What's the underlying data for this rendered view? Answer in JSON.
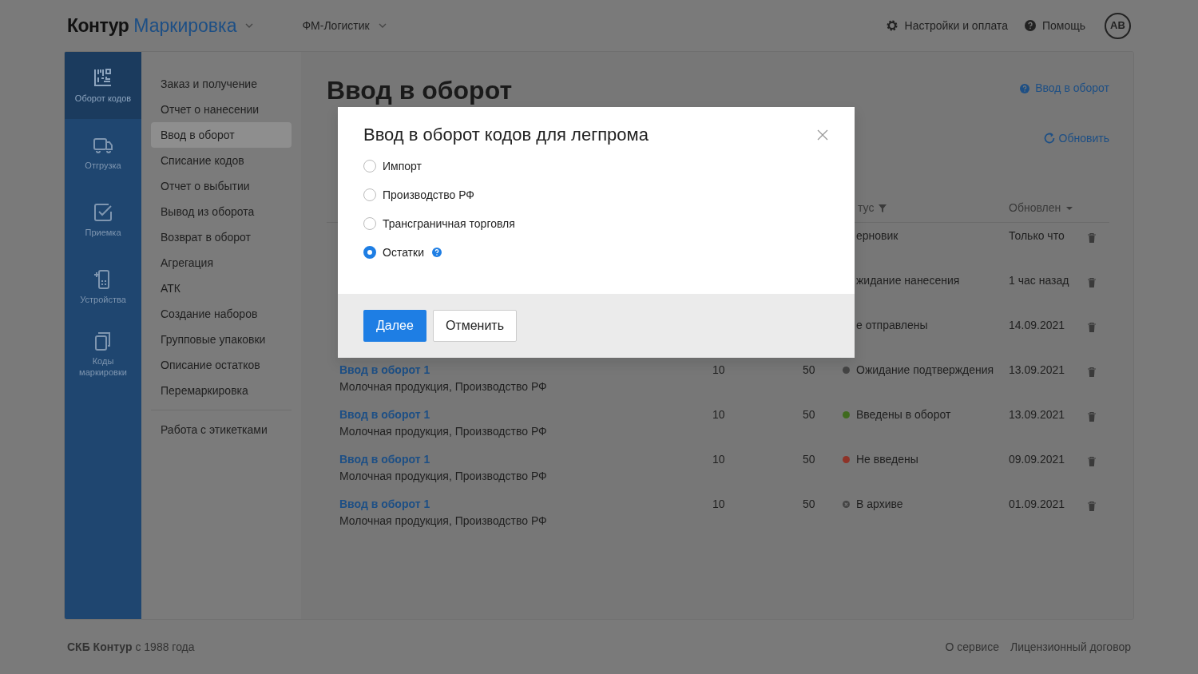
{
  "topbar": {
    "brand": "Контур",
    "product": "Маркировка",
    "org": "ФМ-Логистик",
    "settings": "Настройки и оплата",
    "help": "Помощь",
    "avatar": "AB"
  },
  "rail": [
    {
      "label": "Оборот кодов",
      "selected": true
    },
    {
      "label": "Отгрузка",
      "selected": false
    },
    {
      "label": "Приемка",
      "selected": false
    },
    {
      "label": "Устройства",
      "selected": false
    },
    {
      "label": "Коды маркировки",
      "selected": false
    }
  ],
  "nav": [
    [
      {
        "label": "Заказ и получение",
        "selected": false
      },
      {
        "label": "Отчет о нанесении",
        "selected": false
      },
      {
        "label": "Ввод в оборот",
        "selected": true
      },
      {
        "label": "Списание кодов",
        "selected": false
      },
      {
        "label": "Отчет о выбытии",
        "selected": false
      },
      {
        "label": "Вывод из оборота",
        "selected": false
      },
      {
        "label": "Возврат в оборот",
        "selected": false
      },
      {
        "label": "Агрегация",
        "selected": false
      },
      {
        "label": "АТК",
        "selected": false
      },
      {
        "label": "Создание наборов",
        "selected": false
      },
      {
        "label": "Групповые упаковки",
        "selected": false
      },
      {
        "label": "Описание остатков",
        "selected": false
      },
      {
        "label": "Перемаркировка",
        "selected": false
      }
    ],
    [
      {
        "label": "Работа с этикетками",
        "selected": false
      }
    ]
  ],
  "content": {
    "title": "Ввод в оборот",
    "help_link": "Ввод в оборот",
    "refresh": "Обновить"
  },
  "table": {
    "columns": [
      {
        "label": "тус",
        "kind": "filter"
      },
      {
        "label": "Обновлен",
        "kind": "sort"
      }
    ],
    "rows": [
      {
        "kind": "plain",
        "status": "ерновик",
        "updated": "Только что"
      },
      {
        "kind": "plain",
        "status": "жидание нанесения",
        "updated": "1 час назад"
      },
      {
        "kind": "plain",
        "status": "е отправлены",
        "updated": "14.09.2021"
      },
      {
        "kind": "dot",
        "color": "#444444",
        "title": "Ввод в оборот 1",
        "subtitle": "Молочная продукция, Производство РФ",
        "count": "10",
        "total": "50",
        "status": "Ожидание подтверждения",
        "updated": "13.09.2021"
      },
      {
        "kind": "dot",
        "color": "#3f6a1e",
        "title": "Ввод в оборот 1",
        "subtitle": "Молочная продукция, Производство РФ",
        "count": "10",
        "total": "50",
        "status": "Введены в оборот",
        "updated": "13.09.2021"
      },
      {
        "kind": "dot",
        "color": "#8e3328",
        "title": "Ввод в оборот 1",
        "subtitle": "Молочная продукция, Производство РФ",
        "count": "10",
        "total": "50",
        "status": "Не введены",
        "updated": "09.09.2021"
      },
      {
        "kind": "archived",
        "title": "Ввод в оборот 1",
        "subtitle": "Молочная продукция, Производство РФ",
        "count": "10",
        "total": "50",
        "status": "В архиве",
        "updated": "01.09.2021"
      }
    ]
  },
  "modal": {
    "title": "Ввод в оборот кодов для легпрома",
    "options": [
      {
        "label": "Импорт",
        "selected": false,
        "help": false
      },
      {
        "label": "Производство РФ",
        "selected": false,
        "help": false
      },
      {
        "label": "Трансграничная торговля",
        "selected": false,
        "help": false
      },
      {
        "label": "Остатки",
        "selected": true,
        "help": true
      }
    ],
    "buttons": [
      {
        "label": "Далее",
        "kind": "primary"
      },
      {
        "label": "Отменить",
        "kind": "secondary"
      }
    ]
  },
  "footer": {
    "copyright": "**СКБ Контур** с 1988 года",
    "links": [
      "О сервисе",
      "Лицензионный договор"
    ]
  }
}
